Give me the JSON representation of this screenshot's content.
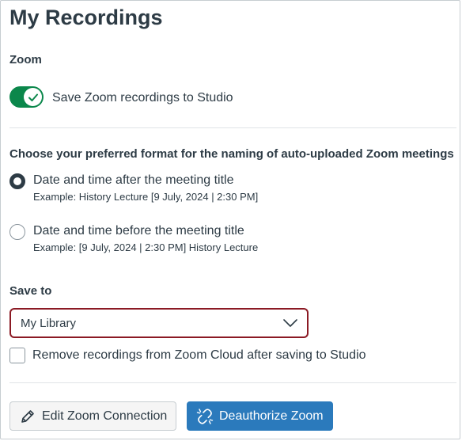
{
  "page": {
    "title": "My Recordings"
  },
  "zoom": {
    "section_label": "Zoom",
    "toggle_label": "Save Zoom recordings to Studio",
    "toggle_on": true
  },
  "naming": {
    "heading": "Choose your preferred format for the naming of auto-uploaded Zoom meetings",
    "options": [
      {
        "label": "Date and time after the meeting title",
        "example": "Example: History Lecture [9 July, 2024 | 2:30 PM]",
        "checked": true
      },
      {
        "label": "Date and time before the meeting title",
        "example": "Example: [9 July, 2024 | 2:30 PM] History Lecture",
        "checked": false
      }
    ]
  },
  "save_to": {
    "label": "Save to",
    "selected": "My Library"
  },
  "remove_cloud": {
    "label": "Remove recordings from Zoom Cloud after saving to Studio",
    "checked": false
  },
  "buttons": {
    "edit": "Edit Zoom Connection",
    "deauthorize": "Deauthorize Zoom"
  },
  "colors": {
    "toggle_on": "#0b874b",
    "primary_button": "#2b7abc",
    "focus_ring": "#8b1a24",
    "text": "#2d3b45"
  }
}
